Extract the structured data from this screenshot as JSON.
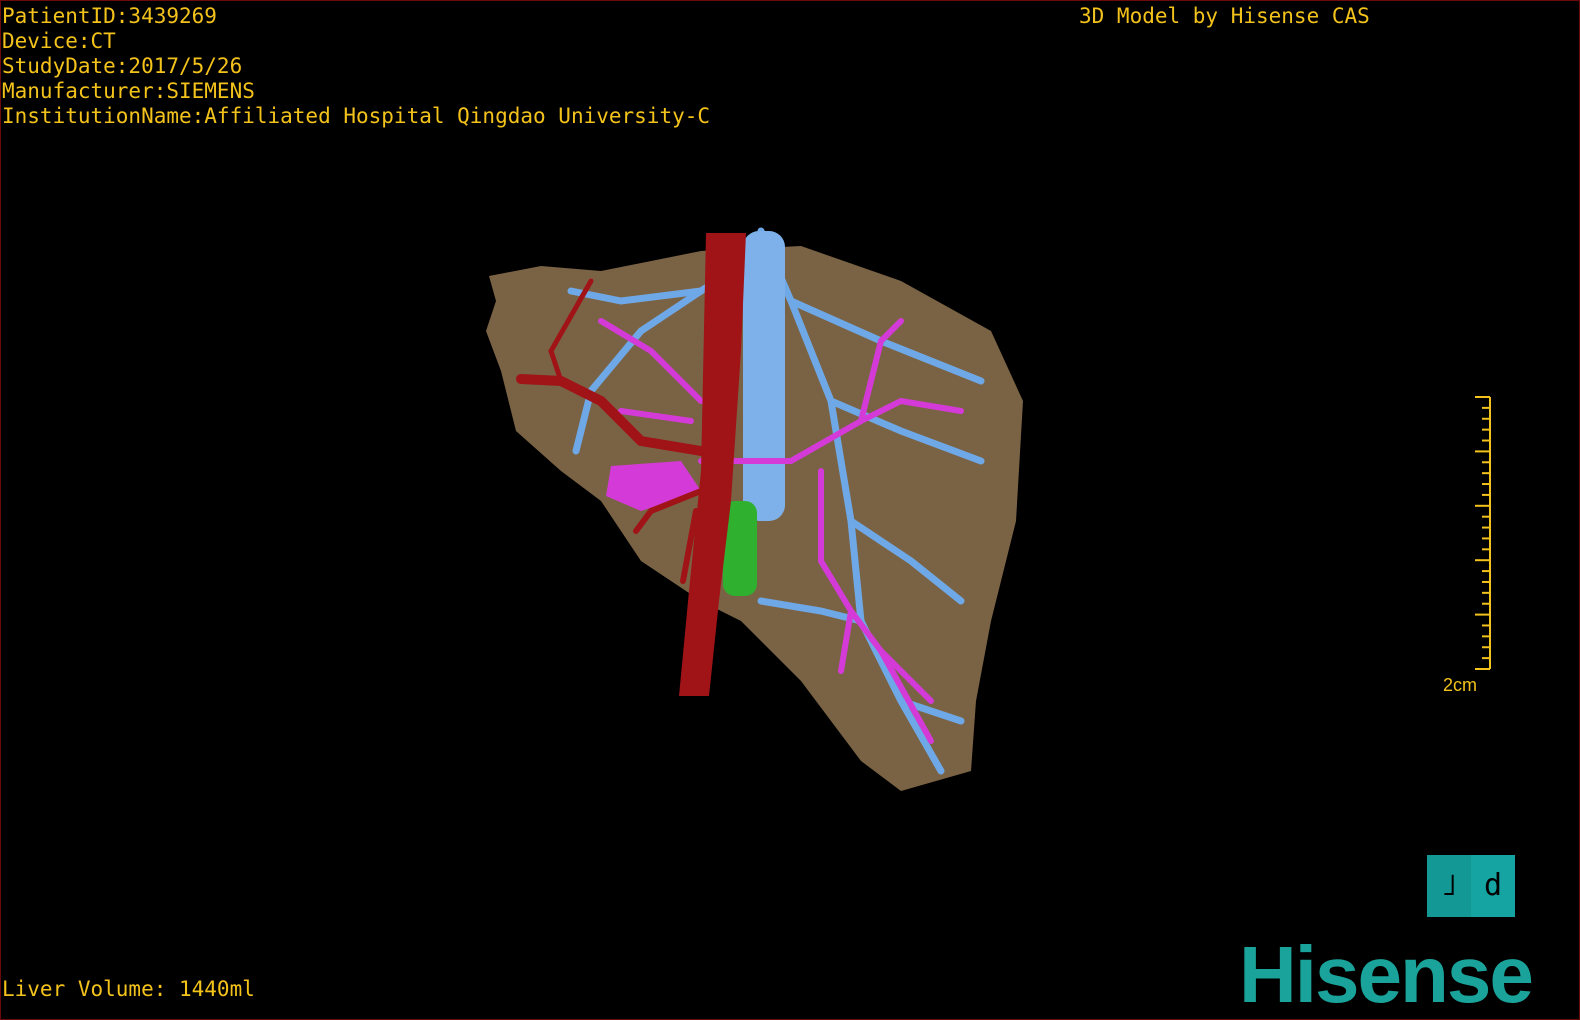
{
  "overlay": {
    "patient_id": "PatientID:3439269",
    "device": "Device:CT",
    "study_date": "StudyDate:2017/5/26",
    "manufacturer": "Manufacturer:SIEMENS",
    "institution": "InstitutionName:Affiliated Hospital Qingdao University-C",
    "model_credit": "3D Model by Hisense CAS",
    "liver_volume": "Liver Volume: 1440ml"
  },
  "scale_bar": {
    "label": "2cm",
    "major_divisions": 5,
    "minor_per_major": 5
  },
  "orientation_cube": {
    "left_glyph": "˩",
    "right_glyph": "d"
  },
  "brand": {
    "logo": "Hisense",
    "color": "#1aa39a"
  },
  "colors": {
    "text": "#f3c21b",
    "liver": "#7a6344",
    "artery": "#a01418",
    "portal_vein": "#d43ad8",
    "hepatic_vein": "#6fa8e6",
    "tumor": "#2fb02f"
  }
}
